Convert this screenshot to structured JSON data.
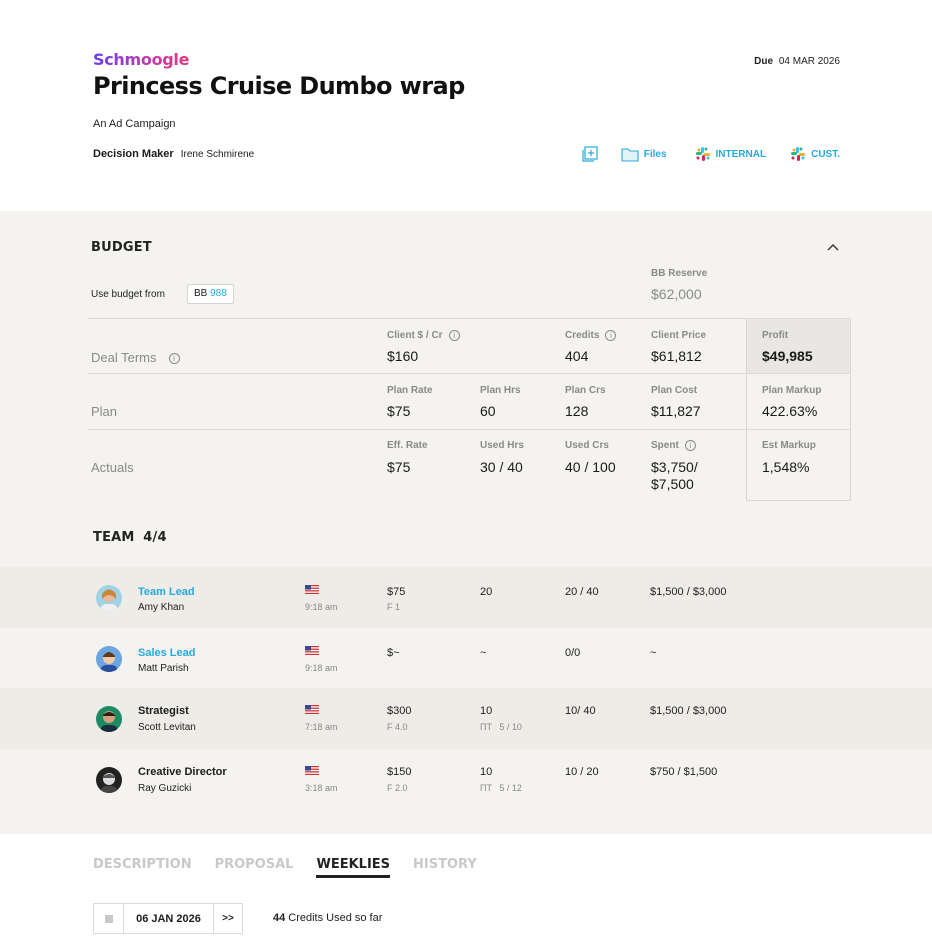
{
  "header": {
    "brand": "Schmoogle",
    "title": "Princess Cruise Dumbo wrap",
    "subtitle": "An Ad Campaign",
    "decision_maker_label": "Decision Maker",
    "decision_maker_value": "Irene Schmirene",
    "due_label": "Due",
    "due_value": "04 MAR 2026",
    "actions": {
      "files": "Files",
      "internal": "INTERNAL",
      "cust": "CUST."
    }
  },
  "budget": {
    "title": "BUDGET",
    "use_budget_label": "Use budget from",
    "bb_prefix": "BB",
    "bb_number": "988",
    "reserve_label": "BB Reserve",
    "reserve_value": "$62,000",
    "deal_terms": {
      "label": "Deal Terms",
      "client_rate_label": "Client $ / Cr",
      "client_rate_value": "$160",
      "credits_label": "Credits",
      "credits_value": "404",
      "client_price_label": "Client Price",
      "client_price_value": "$61,812",
      "profit_label": "Profit",
      "profit_value": "$49,985"
    },
    "plan": {
      "label": "Plan",
      "rate_label": "Plan Rate",
      "rate_value": "$75",
      "hrs_label": "Plan Hrs",
      "hrs_value": "60",
      "crs_label": "Plan Crs",
      "crs_value": "128",
      "cost_label": "Plan Cost",
      "cost_value": "$11,827",
      "markup_label": "Plan Markup",
      "markup_value": "422.63%"
    },
    "actuals": {
      "label": "Actuals",
      "rate_label": "Eff. Rate",
      "rate_value": "$75",
      "hrs_label": "Used Hrs",
      "hrs_value": "30 / 40",
      "crs_label": "Used Crs",
      "crs_value": "40 / 100",
      "spent_label": "Spent",
      "spent_value_1": "$3,750/",
      "spent_value_2": "$7,500",
      "markup_label": "Est Markup",
      "markup_value": "1,548%"
    }
  },
  "team": {
    "title": "TEAM",
    "count": "4/4",
    "members": [
      {
        "role": "Team Lead",
        "name": "Amy Khan",
        "time": "9:18 am",
        "rate": "$75",
        "rate_sub": "F 1",
        "hrs": "20",
        "hrs_sub": "",
        "crs": "20 / 40",
        "cost": "$1,500 / $3,000"
      },
      {
        "role": "Sales Lead",
        "name": "Matt Parish",
        "time": "9:18 am",
        "rate": "$~",
        "rate_sub": "",
        "hrs": "~",
        "hrs_sub": "",
        "crs": "0/0",
        "cost": "~"
      },
      {
        "role": "Strategist",
        "name": "Scott Levitan",
        "time": "7:18 am",
        "rate": "$300",
        "rate_sub": "F 4.0",
        "hrs": "10",
        "hrs_sub": "ΠΤ   5 / 10",
        "crs": "10/ 40",
        "cost": "$1,500 / $3,000"
      },
      {
        "role": "Creative Director",
        "name": "Ray Guzicki",
        "time": "3:18 am",
        "rate": "$150",
        "rate_sub": "F 2.0",
        "hrs": "10",
        "hrs_sub": "ΠΤ   5 / 12",
        "crs": "10 / 20",
        "cost": "$750 / $1,500"
      }
    ]
  },
  "tabs": [
    "DESCRIPTION",
    "PROPOSAL",
    "WEEKLIES",
    "HISTORY"
  ],
  "active_tab": "WEEKLIES",
  "weekly": {
    "date": "06 JAN 2026",
    "next": ">>",
    "credits_count": "44",
    "credits_text": "Credits Used so far"
  },
  "colors": {
    "accent": "#27a9dd",
    "section_bg": "#f4f3ef",
    "alt_row": "#eeece7"
  }
}
